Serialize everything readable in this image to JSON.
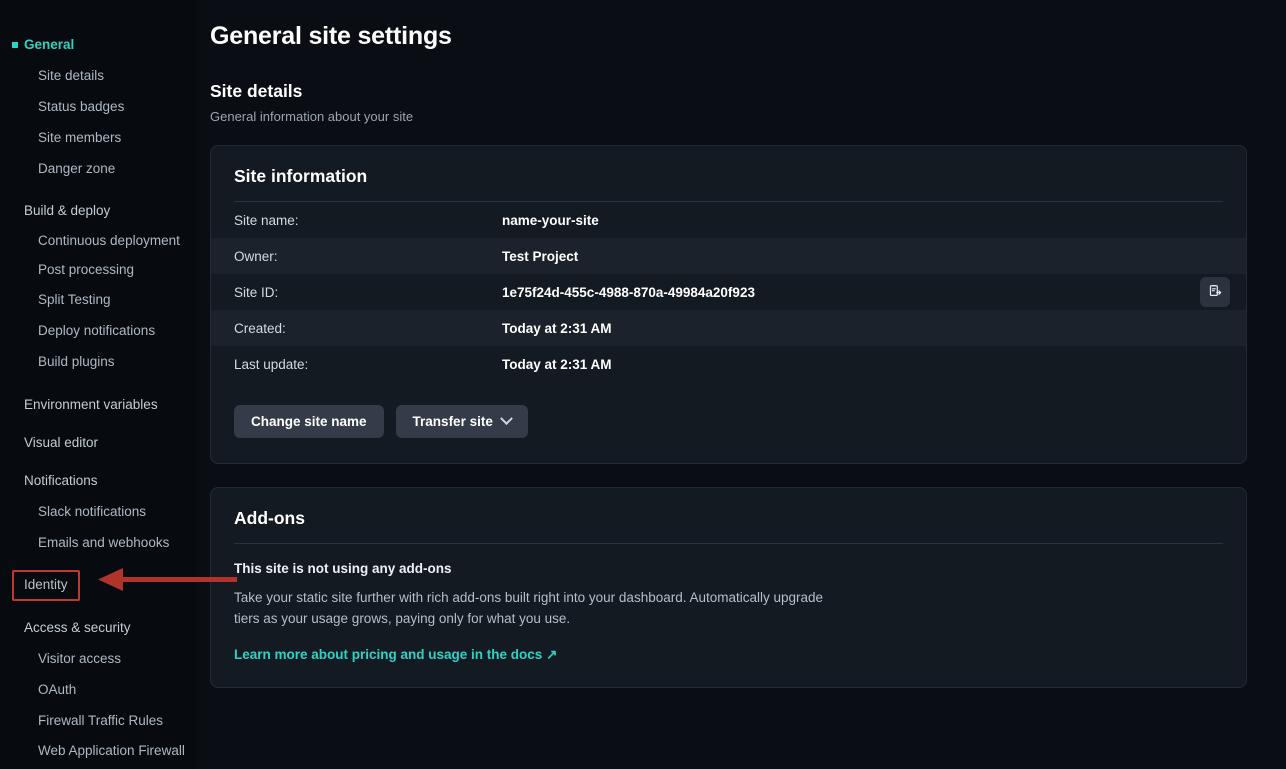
{
  "sidebar": {
    "groups": [
      {
        "name": "general-group",
        "header": {
          "label": "General",
          "active": true
        },
        "items": [
          {
            "label": "Site details"
          },
          {
            "label": "Status badges"
          },
          {
            "label": "Site members"
          },
          {
            "label": "Danger zone"
          }
        ]
      },
      {
        "name": "build-deploy-group",
        "header": {
          "label": "Build & deploy",
          "active": false
        },
        "items": [
          {
            "label": "Continuous deployment"
          },
          {
            "label": "Post processing"
          },
          {
            "label": "Split Testing"
          },
          {
            "label": "Deploy notifications"
          },
          {
            "label": "Build plugins"
          }
        ]
      },
      {
        "name": "environment-variables-group",
        "header": {
          "label": "Environment variables",
          "active": false
        },
        "items": []
      },
      {
        "name": "visual-editor-group",
        "header": {
          "label": "Visual editor",
          "active": false
        },
        "items": []
      },
      {
        "name": "notifications-group",
        "header": {
          "label": "Notifications",
          "active": false
        },
        "items": [
          {
            "label": "Slack notifications"
          },
          {
            "label": "Emails and webhooks"
          }
        ]
      },
      {
        "name": "identity-group",
        "header": {
          "label": "Identity",
          "active": false,
          "annotated": true
        },
        "items": []
      },
      {
        "name": "access-security-group",
        "header": {
          "label": "Access & security",
          "active": false
        },
        "items": [
          {
            "label": "Visitor access"
          },
          {
            "label": "OAuth"
          },
          {
            "label": "Firewall Traffic Rules"
          },
          {
            "label": "Web Application Firewall"
          }
        ]
      }
    ]
  },
  "main": {
    "page_title": "General site settings",
    "section": {
      "title": "Site details",
      "subtitle": "General information about your site"
    },
    "site_information": {
      "title": "Site information",
      "rows": [
        {
          "label": "Site name:",
          "value": "name-your-site"
        },
        {
          "label": "Owner:",
          "value": "Test Project"
        },
        {
          "label": "Site ID:",
          "value": "1e75f24d-455c-4988-870a-49984a20f923"
        },
        {
          "label": "Created:",
          "value": "Today at 2:31 AM"
        },
        {
          "label": "Last update:",
          "value": "Today at 2:31 AM"
        }
      ],
      "copy_icon": "copy-clipboard-icon",
      "actions": {
        "change_site_name": "Change site name",
        "transfer_site": "Transfer site"
      }
    },
    "addons": {
      "title": "Add-ons",
      "empty_heading": "This site is not using any add-ons",
      "description": "Take your static site further with rich add-ons built right into your dashboard. Automatically upgrade tiers as your usage grows, paying only for what you use.",
      "link_label": "Learn more about pricing and usage in the docs",
      "link_icon": "external-link-arrow-icon"
    }
  },
  "annotation": {
    "color": "#b0342a",
    "target": "Identity"
  },
  "colors": {
    "accent": "#2ad4c5",
    "page_background": "#0a0e14",
    "sidebar_background": "#070b10",
    "card_background": "#141a22",
    "row_alt_background": "#1c222b",
    "button_background": "#333c48",
    "annotation_red": "#b0342a"
  }
}
